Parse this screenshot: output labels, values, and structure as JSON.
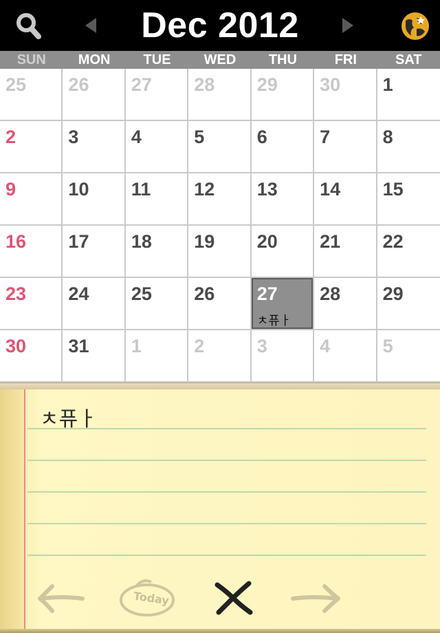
{
  "header": {
    "title": "Dec 2012",
    "search_icon": "search-icon",
    "prev_icon": "chevron-left-icon",
    "next_icon": "chevron-right-icon",
    "globe_icon": "globe-icon"
  },
  "weekdays": [
    "SUN",
    "MON",
    "TUE",
    "WED",
    "THU",
    "FRI",
    "SAT"
  ],
  "weeks": [
    [
      {
        "d": "25",
        "type": "other"
      },
      {
        "d": "26",
        "type": "other"
      },
      {
        "d": "27",
        "type": "other"
      },
      {
        "d": "28",
        "type": "other"
      },
      {
        "d": "29",
        "type": "other"
      },
      {
        "d": "30",
        "type": "other"
      },
      {
        "d": "1",
        "type": "cur"
      }
    ],
    [
      {
        "d": "2",
        "type": "sun"
      },
      {
        "d": "3",
        "type": "cur"
      },
      {
        "d": "4",
        "type": "cur"
      },
      {
        "d": "5",
        "type": "cur"
      },
      {
        "d": "6",
        "type": "cur"
      },
      {
        "d": "7",
        "type": "cur"
      },
      {
        "d": "8",
        "type": "cur"
      }
    ],
    [
      {
        "d": "9",
        "type": "sun"
      },
      {
        "d": "10",
        "type": "cur"
      },
      {
        "d": "11",
        "type": "cur"
      },
      {
        "d": "12",
        "type": "cur"
      },
      {
        "d": "13",
        "type": "cur"
      },
      {
        "d": "14",
        "type": "cur"
      },
      {
        "d": "15",
        "type": "cur"
      }
    ],
    [
      {
        "d": "16",
        "type": "sun"
      },
      {
        "d": "17",
        "type": "cur"
      },
      {
        "d": "18",
        "type": "cur"
      },
      {
        "d": "19",
        "type": "cur"
      },
      {
        "d": "20",
        "type": "cur"
      },
      {
        "d": "21",
        "type": "cur"
      },
      {
        "d": "22",
        "type": "cur"
      }
    ],
    [
      {
        "d": "23",
        "type": "sun"
      },
      {
        "d": "24",
        "type": "cur"
      },
      {
        "d": "25",
        "type": "cur"
      },
      {
        "d": "26",
        "type": "cur"
      },
      {
        "d": "27",
        "type": "today",
        "event": "ㅊ퓨ㅏ"
      },
      {
        "d": "28",
        "type": "cur"
      },
      {
        "d": "29",
        "type": "cur"
      }
    ],
    [
      {
        "d": "30",
        "type": "sun"
      },
      {
        "d": "31",
        "type": "cur"
      },
      {
        "d": "1",
        "type": "other"
      },
      {
        "d": "2",
        "type": "other"
      },
      {
        "d": "3",
        "type": "other"
      },
      {
        "d": "4",
        "type": "other"
      },
      {
        "d": "5",
        "type": "other"
      }
    ]
  ],
  "note": {
    "text": "ㅊ퓨ㅏ",
    "today_label": "Today",
    "back_icon": "arrow-left-icon",
    "delete_icon": "delete-x-icon",
    "forward_icon": "arrow-right-icon"
  },
  "colors": {
    "header_bg": "#000000",
    "weekday_bar": "#8e8e8e",
    "sunday_red": "#e05575",
    "today_bg": "#8f8f8f",
    "notepad_yellow": "#fff7c4"
  }
}
